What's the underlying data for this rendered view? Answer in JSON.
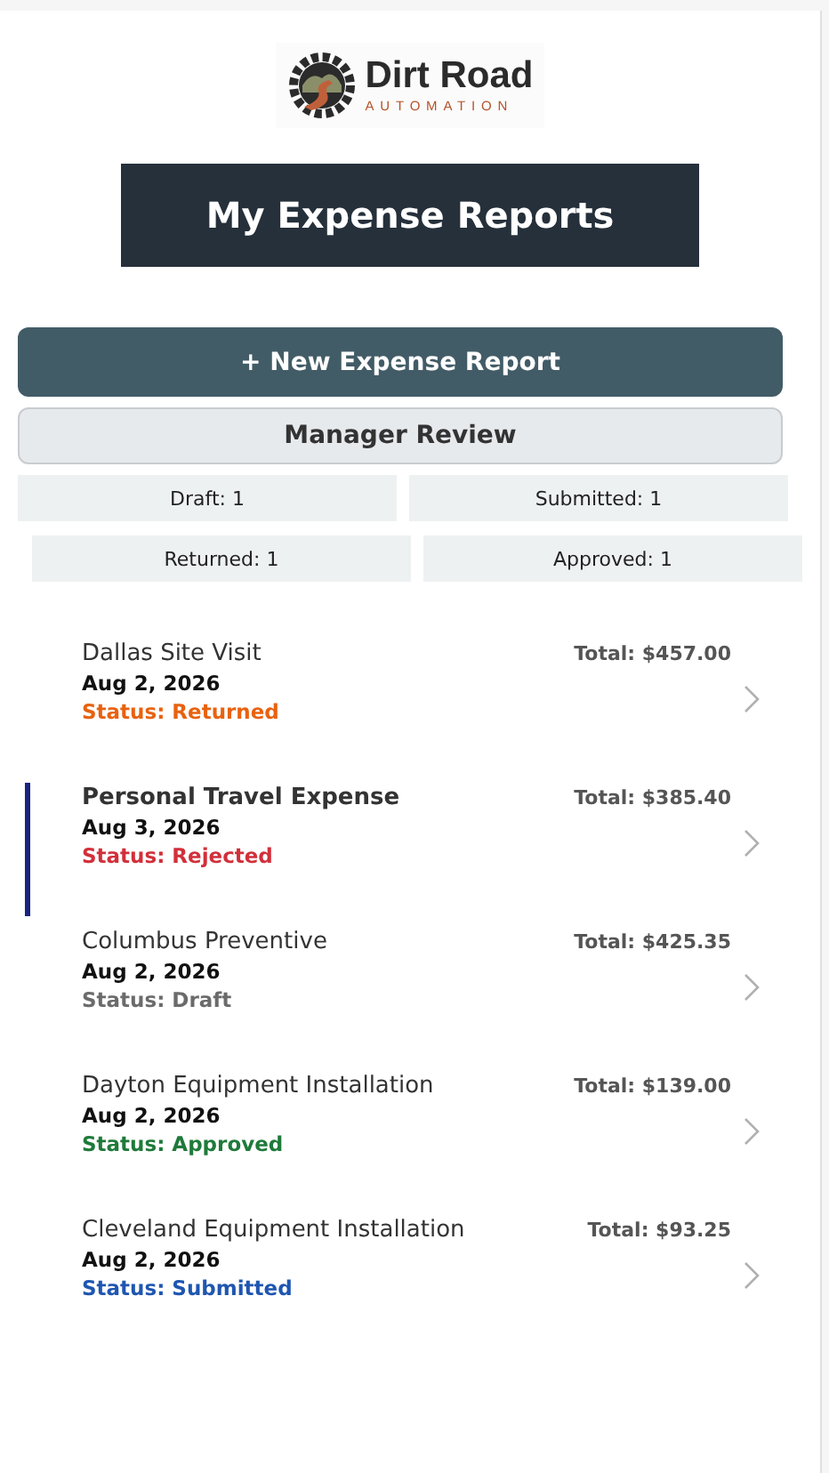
{
  "logo": {
    "name": "Dirt Road",
    "tagline": "AUTOMATION"
  },
  "title": "My Expense Reports",
  "new_button": "+ New Expense Report",
  "review_button": "Manager Review",
  "counts": [
    [
      "Draft: 1",
      "Submitted: 1"
    ],
    [
      "Returned: 1",
      "Approved: 1"
    ]
  ],
  "reports": [
    {
      "name": "Dallas Site Visit",
      "date": "Aug 2, 2026",
      "status": "Status: Returned",
      "color": "#e8620f",
      "total": "Total: $457.00",
      "selected": false
    },
    {
      "name": "Personal Travel Expense",
      "date": "Aug 3, 2026",
      "status": "Status: Rejected",
      "color": "#d1303a",
      "total": "Total: $385.40",
      "selected": true
    },
    {
      "name": "Columbus Preventive",
      "date": "Aug 2, 2026",
      "status": "Status: Draft",
      "color": "#6b6b6b",
      "total": "Total: $425.35",
      "selected": false
    },
    {
      "name": "Dayton Equipment Installation",
      "date": "Aug 2, 2026",
      "status": "Status: Approved",
      "color": "#1f7a3a",
      "total": "Total: $139.00",
      "selected": false
    },
    {
      "name": "Cleveland Equipment Installation",
      "date": "Aug 2, 2026",
      "status": "Status: Submitted",
      "color": "#1f56b0",
      "total": "Total: $93.25",
      "selected": false
    }
  ]
}
